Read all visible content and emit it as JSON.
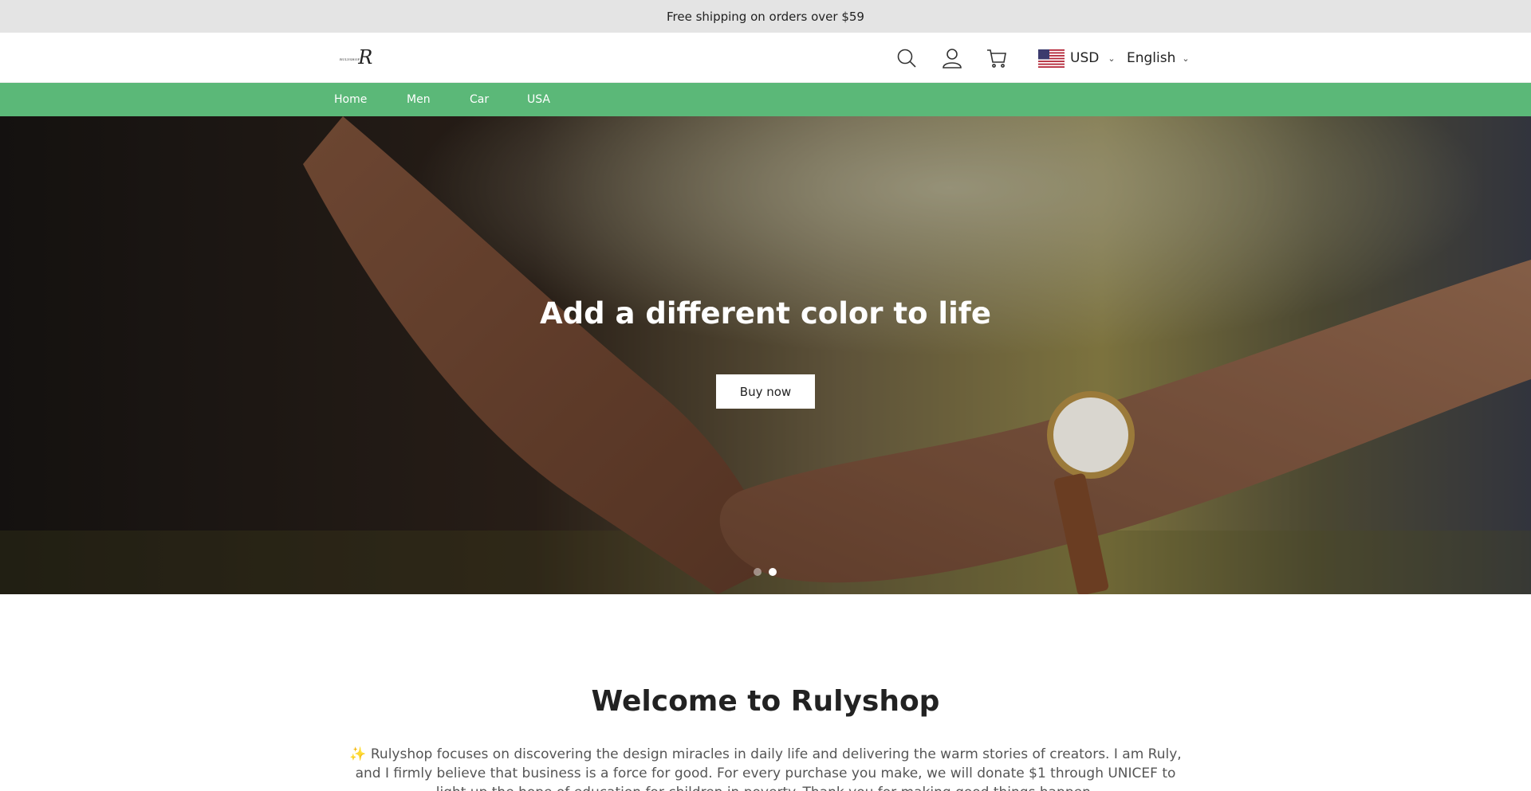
{
  "announcement": "Free shipping on orders over $59",
  "header": {
    "logo_small": "RULYSHOP",
    "logo_big": "R",
    "currency": "USD",
    "language": "English"
  },
  "nav": {
    "items": [
      {
        "label": "Home"
      },
      {
        "label": "Men"
      },
      {
        "label": "Car"
      },
      {
        "label": "USA"
      }
    ]
  },
  "hero": {
    "title": "Add a different color to life",
    "button": "Buy now",
    "slides_total": 2,
    "slide_active": 2
  },
  "welcome": {
    "title": "Welcome to Rulyshop",
    "text": "✨ Rulyshop focuses on discovering the design miracles in daily life and delivering the warm stories of creators. I am Ruly, and I firmly believe that business is a force for good. For every purchase you make, we will donate $1 through UNICEF to light up the hope of education for children in poverty. Thank you for making good things happen."
  },
  "colors": {
    "announce_bg": "#e4e4e4",
    "nav_bg": "#5bb878"
  }
}
